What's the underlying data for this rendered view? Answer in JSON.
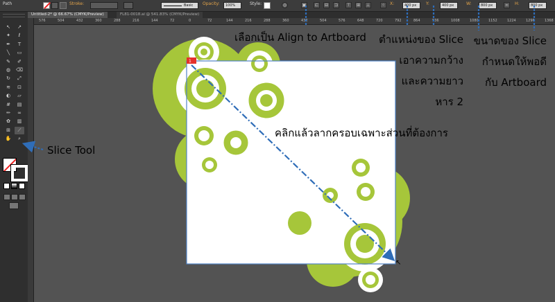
{
  "control_bar": {
    "path_label": "Path",
    "stroke_label": "Stroke:",
    "brush_label": "Basic",
    "opacity_label": "Opacity:",
    "opacity_value": "100%",
    "style_label": "Style:",
    "x_label": "X:",
    "x_value": "400 px",
    "y_label": "Y:",
    "y_value": "400 px",
    "w_label": "W:",
    "w_value": "800 px",
    "h_label": "H:",
    "h_value": "800 px"
  },
  "tabs": [
    {
      "label": "Untitled-2* @ 66.67% (CMYK/Preview)"
    },
    {
      "label": "FL81-0018.ai @ 541.83% (CMYK/Preview)"
    }
  ],
  "ruler": {
    "ticks": [
      "576",
      "504",
      "432",
      "360",
      "288",
      "216",
      "144",
      "72",
      "0",
      "72",
      "144",
      "216",
      "288",
      "360",
      "432",
      "504",
      "576",
      "648",
      "720",
      "792",
      "864",
      "936",
      "1008",
      "1080",
      "1152",
      "1224",
      "1296",
      "1368"
    ]
  },
  "slice_badge": "1",
  "annotations": {
    "align_artboard": "เลือกเป็น Align to Artboard",
    "slice_position_1": "ตำแหน่งของ Slice",
    "slice_position_2": "เอาความกว้าง",
    "slice_position_3": "และความยาว",
    "slice_position_4": "หาร 2",
    "slice_size_1": "ขนาดของ Slice",
    "slice_size_2": "กำหนดให้พอดี",
    "slice_size_3": "กับ Artboard",
    "drag_instruction": "คลิกแล้วลากครอบเฉพาะส่วนที่ต้องการ",
    "slice_tool": "Slice Tool"
  },
  "colors": {
    "accent_green": "#a6c63a",
    "annotation_blue": "#2f6db8",
    "artboard": "#ffffff",
    "canvas": "#535353"
  },
  "icons": [
    "selection-icon",
    "direct-selection-icon",
    "magic-wand-icon",
    "lasso-icon",
    "pen-icon",
    "type-icon",
    "line-icon",
    "rectangle-icon",
    "paintbrush-icon",
    "pencil-icon",
    "blob-brush-icon",
    "eraser-icon",
    "rotate-icon",
    "scale-icon",
    "width-icon",
    "free-transform-icon",
    "shape-builder-icon",
    "perspective-icon",
    "mesh-icon",
    "gradient-icon",
    "eyedropper-icon",
    "blend-icon",
    "symbol-sprayer-icon",
    "graph-icon",
    "artboard-icon",
    "slice-icon",
    "hand-icon",
    "zoom-icon"
  ]
}
